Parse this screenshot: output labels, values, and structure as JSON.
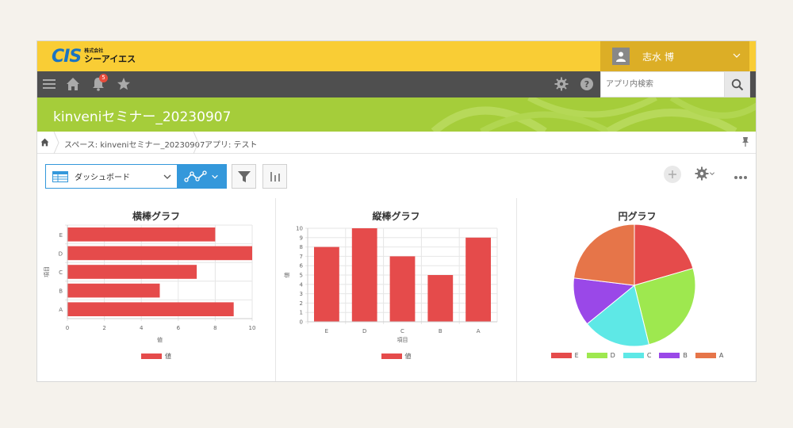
{
  "header": {
    "logo_mark": "CIS",
    "logo_sub": "株式会社",
    "logo_name": "シーアイエス",
    "user_name": "志水 博"
  },
  "nav": {
    "notification_count": "5",
    "search_placeholder": "アプリ内検索"
  },
  "app": {
    "title": "kinveniセミナー_20230907"
  },
  "breadcrumb": {
    "space": "スペース: kinveniセミナー_20230907",
    "app": "アプリ: テスト"
  },
  "toolbar": {
    "view_label": "ダッシュボード"
  },
  "colors": {
    "header": "#f9cd35",
    "user_area": "#dcae26",
    "nav": "#4f4f4f",
    "banner": "#a5cd3a",
    "accent": "#3498db",
    "bar": "#e54b4b"
  },
  "chart_data": [
    {
      "type": "bar",
      "orientation": "horizontal",
      "title": "横棒グラフ",
      "categories": [
        "E",
        "D",
        "C",
        "B",
        "A"
      ],
      "series": [
        {
          "name": "値",
          "values": [
            8,
            10,
            7,
            5,
            9
          ],
          "color": "#e54b4b"
        }
      ],
      "xlabel": "値",
      "ylabel": "項目",
      "xlim": [
        0,
        10
      ],
      "xticks": [
        "0",
        "2",
        "4",
        "6",
        "8",
        "10"
      ],
      "grid": true,
      "legend": "bottom"
    },
    {
      "type": "bar",
      "orientation": "vertical",
      "title": "縦棒グラフ",
      "categories": [
        "E",
        "D",
        "C",
        "B",
        "A"
      ],
      "series": [
        {
          "name": "値",
          "values": [
            8,
            10,
            7,
            5,
            9
          ],
          "color": "#e54b4b"
        }
      ],
      "xlabel": "項目",
      "ylabel": "値",
      "ylim": [
        0,
        10
      ],
      "yticks": [
        "0",
        "1",
        "2",
        "3",
        "4",
        "5",
        "6",
        "7",
        "8",
        "9",
        "10"
      ],
      "grid": true,
      "legend": "bottom"
    },
    {
      "type": "pie",
      "title": "円グラフ",
      "labels": [
        "E",
        "D",
        "C",
        "B",
        "A"
      ],
      "values": [
        8,
        10,
        7,
        5,
        9
      ],
      "colors": [
        "#e54b4b",
        "#9ee84f",
        "#5ee8e6",
        "#9a48e8",
        "#e67549"
      ],
      "legend": "bottom"
    }
  ]
}
